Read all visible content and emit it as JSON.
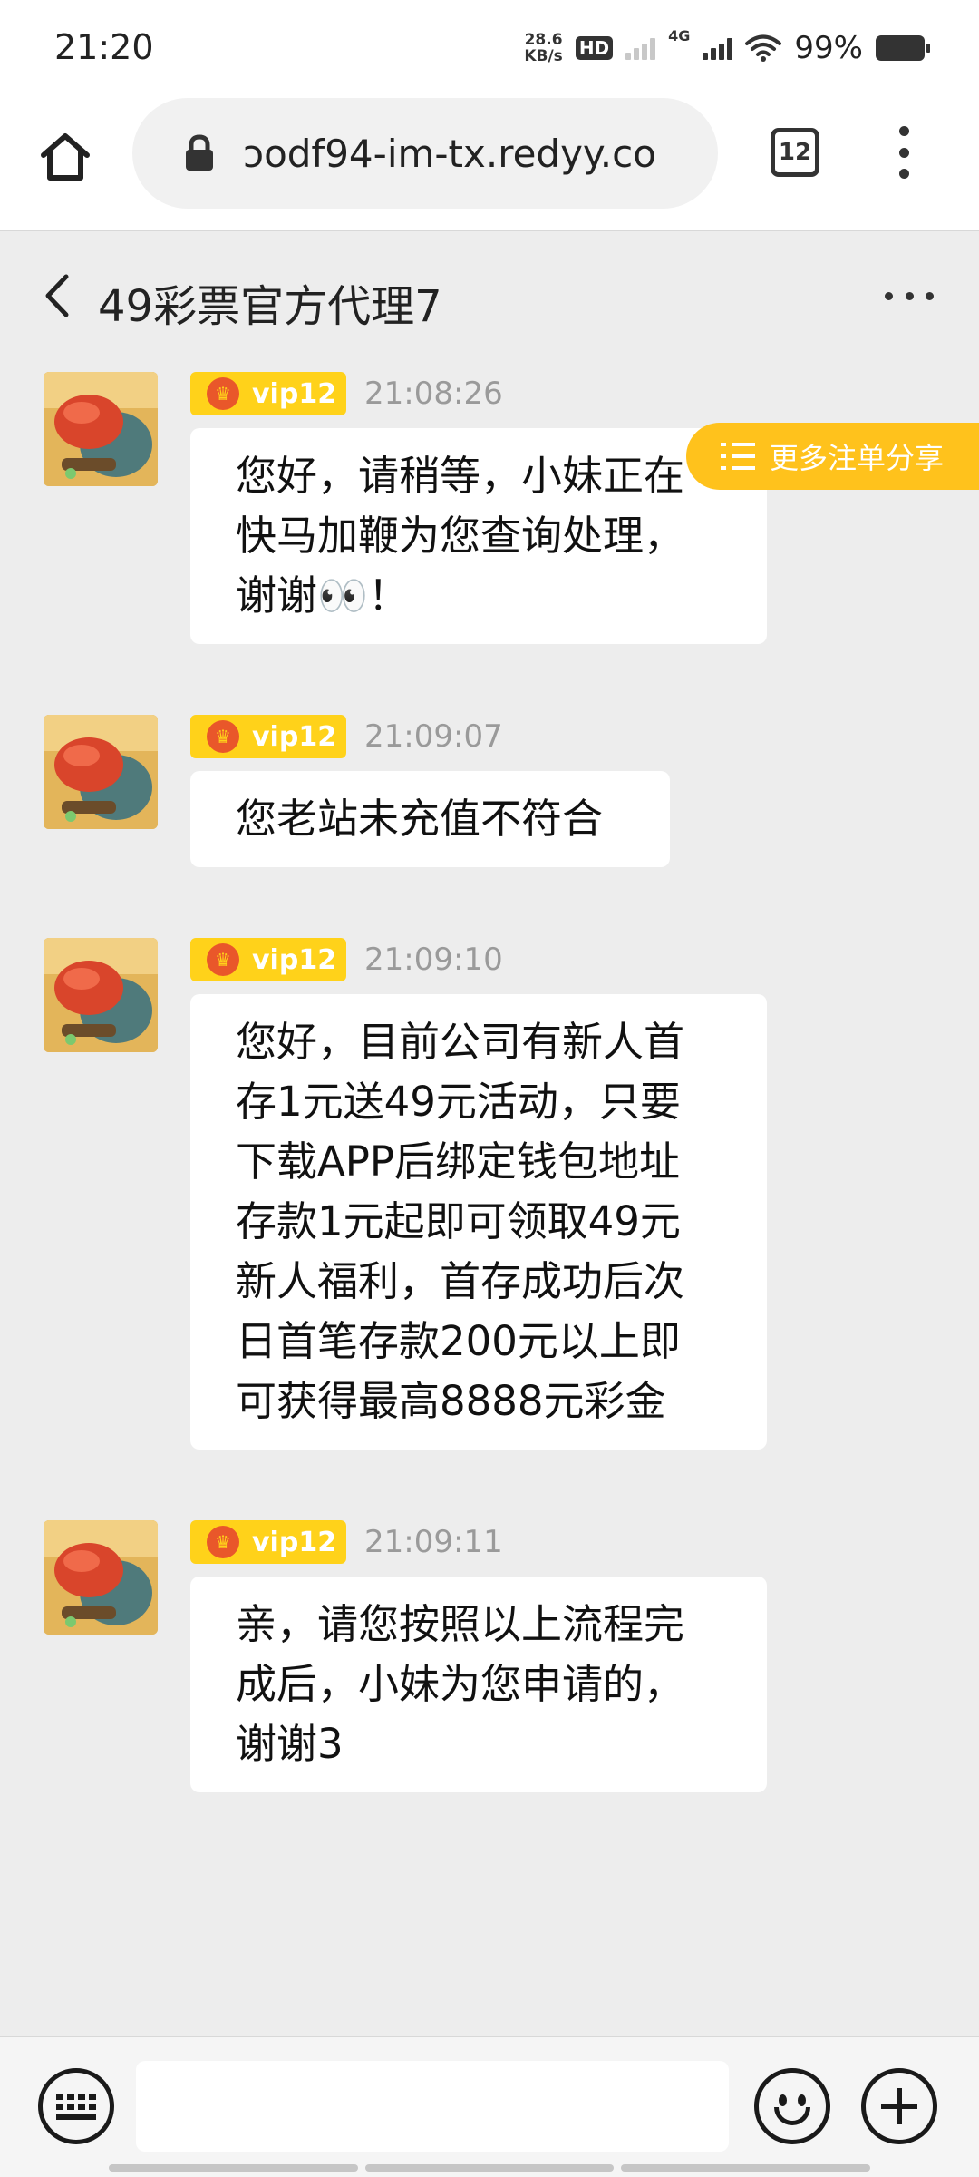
{
  "status_bar": {
    "time": "21:20",
    "net_speed_value": "28.6",
    "net_speed_unit": "KB/s",
    "hd_label": "HD",
    "network_type": "4G",
    "battery_percent": "99%"
  },
  "browser": {
    "url": "ɔodf94-im-tx.redyy.co",
    "tab_count": "12"
  },
  "chat": {
    "title": "49彩票官方代理7",
    "share_button_label": "更多注单分享",
    "messages": [
      {
        "badge": "vip12",
        "time": "21:08:26",
        "lines": [
          "您好，请稍等，小妹正在",
          "快马加鞭为您查询处理，",
          "谢谢👀！"
        ]
      },
      {
        "badge": "vip12",
        "time": "21:09:07",
        "lines": [
          "您老站未充值不符合"
        ]
      },
      {
        "badge": "vip12",
        "time": "21:09:10",
        "lines": [
          "您好，目前公司有新人首",
          "存1元送49元活动，只要",
          "下载APP后绑定钱包地址",
          "存款1元起即可领取49元",
          "新人福利，首存成功后次",
          "日首笔存款200元以上即",
          "可获得最高8888元彩金"
        ]
      },
      {
        "badge": "vip12",
        "time": "21:09:11",
        "lines": [
          "亲，请您按照以上流程完",
          "成后，小妹为您申请的，",
          "谢谢3"
        ]
      }
    ]
  },
  "input": {
    "placeholder": "",
    "value": ""
  },
  "colors": {
    "vip_yellow": "#ffd21a",
    "share_button": "#ffc21c",
    "chat_background": "#ededed",
    "bubble": "#ffffff"
  },
  "icons": {
    "home": "home-icon",
    "lock": "lock-icon",
    "tabs": "tabs-icon",
    "menu": "more-vert-icon",
    "back": "chevron-left-icon",
    "chat_menu": "more-horiz-icon",
    "share": "list-icon",
    "keyboard": "keyboard-icon",
    "emoji": "emoji-icon",
    "plus": "plus-icon"
  }
}
